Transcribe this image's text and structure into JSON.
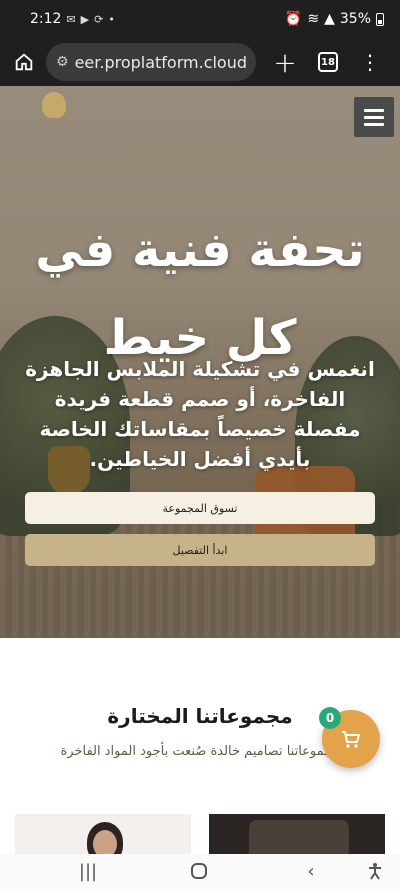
{
  "status_bar": {
    "time": "2:12",
    "battery": "35%"
  },
  "browser": {
    "url": "eer.proplatform.cloud",
    "tab_count": "18"
  },
  "hero": {
    "title": "تحفة فنية في كل خيط",
    "subtitle": "انغمس في تشكيلة الملابس الجاهزة الفاخرة، أو صمم قطعة فريدة مفصلة خصيصاً بمقاساتك الخاصة بأيدي أفضل الخياطين.",
    "shop_button": "تسوق المجموعة",
    "custom_button": "ابدأ التفصيل"
  },
  "collections": {
    "title": "مجموعاتنا المختارة",
    "subtitle": "مجموعاتنا تصاميم خالدة صُنعت بأجود المواد الفاخرة"
  },
  "cart": {
    "count": "0"
  },
  "colors": {
    "accent": "#e3a34a",
    "badge": "#2aa879",
    "custom_button": "#c7b389"
  }
}
